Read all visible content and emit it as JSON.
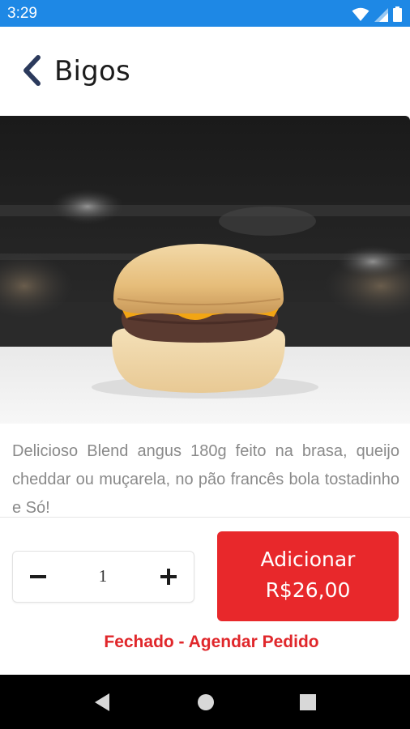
{
  "status_bar": {
    "time": "3:29",
    "icons": [
      "wifi-icon",
      "signal-icon",
      "battery-icon"
    ]
  },
  "header": {
    "back_icon": "chevron-left-icon",
    "title": "Bigos"
  },
  "product": {
    "image_subject": "burger",
    "description": "Delicioso Blend angus 180g feito na brasa, queijo cheddar ou muçarela, no pão francês bola tostadinho e Só!"
  },
  "quantity": {
    "minus_icon": "minus-icon",
    "value": "1",
    "plus_icon": "plus-icon"
  },
  "add_button": {
    "line1": "Adicionar",
    "line2": "R$26,00"
  },
  "notice": "Fechado - Agendar Pedido",
  "nav_bar": {
    "icons": [
      "back-triangle-icon",
      "home-circle-icon",
      "recents-square-icon"
    ]
  },
  "colors": {
    "status_bar": "#1e88e5",
    "accent_red": "#e8282b",
    "title_text": "#1c1c1c",
    "back_icon": "#2b3a5c"
  }
}
